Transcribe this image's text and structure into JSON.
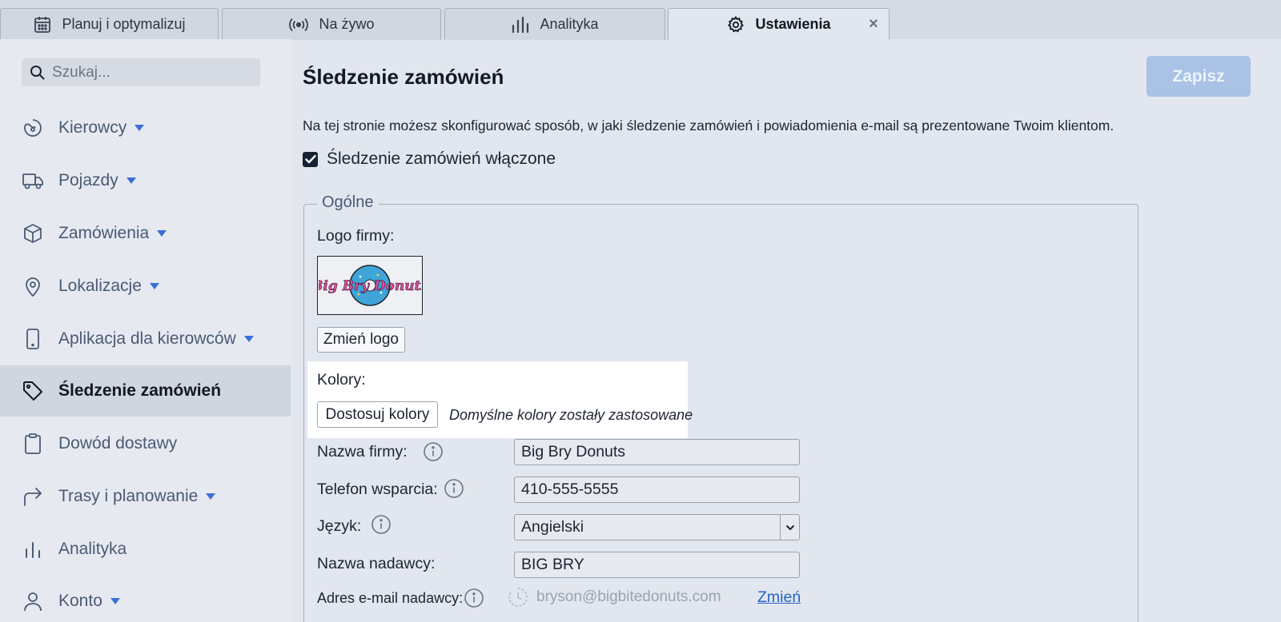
{
  "tabs": [
    {
      "label": "Planuj i optymalizuj",
      "icon": "calendar-icon",
      "active": false
    },
    {
      "label": "Na żywo",
      "icon": "broadcast-icon",
      "active": false
    },
    {
      "label": "Analityka",
      "icon": "bar-chart-icon",
      "active": false
    },
    {
      "label": "Ustawienia",
      "icon": "gear-icon",
      "active": true,
      "close": "×"
    }
  ],
  "sidebar": {
    "search_placeholder": "Szukaj...",
    "items": [
      {
        "label": "Kierowcy",
        "icon": "steering-wheel-icon",
        "dropdown": true
      },
      {
        "label": "Pojazdy",
        "icon": "truck-icon",
        "dropdown": true
      },
      {
        "label": "Zamówienia",
        "icon": "package-icon",
        "dropdown": true
      },
      {
        "label": "Lokalizacje",
        "icon": "map-pin-icon",
        "dropdown": true
      },
      {
        "label": "Aplikacja dla kierowców",
        "icon": "phone-icon",
        "dropdown": true
      },
      {
        "label": "Śledzenie zamówień",
        "icon": "tag-icon",
        "active": true
      },
      {
        "label": "Dowód dostawy",
        "icon": "clipboard-icon"
      },
      {
        "label": "Trasy i planowanie",
        "icon": "route-arrow-icon",
        "dropdown": true
      },
      {
        "label": "Analityka",
        "icon": "bar-chart-icon"
      },
      {
        "label": "Konto",
        "icon": "user-icon",
        "dropdown": true
      }
    ]
  },
  "main": {
    "title": "Śledzenie zamówień",
    "save_label": "Zapisz",
    "description": "Na tej stronie możesz skonfigurować sposób, w jaki śledzenie zamówień i powiadomienia e-mail są prezentowane Twoim klientom.",
    "tracking_enabled_label": "Śledzenie zamówień włączone",
    "tracking_enabled": true,
    "general": {
      "legend": "Ogólne",
      "logo_label": "Logo firmy:",
      "logo_text": "Big Bry Donuts",
      "change_logo_label": "Zmień logo",
      "colors_label": "Kolory:",
      "customize_colors_label": "Dostosuj kolory",
      "colors_note": "Domyślne kolory zostały zastosowane",
      "company_name_label": "Nazwa firmy:",
      "company_name_value": "Big Bry Donuts",
      "support_phone_label": "Telefon wsparcia:",
      "support_phone_value": "410-555-5555",
      "language_label": "Język:",
      "language_value": "Angielski",
      "sender_name_label": "Nazwa nadawcy:",
      "sender_name_value": "BIG BRY",
      "sender_email_label": "Adres e-mail nadawcy:",
      "sender_email_value": "bryson@bigbitedonuts.com",
      "change_link_label": "Zmień"
    }
  },
  "colors": {
    "accent": "#3a6fd8",
    "link": "#2463c8",
    "save_button": "#a9c2e6",
    "logo_donut": "#3fa4d8",
    "logo_text": "#d9509a"
  }
}
